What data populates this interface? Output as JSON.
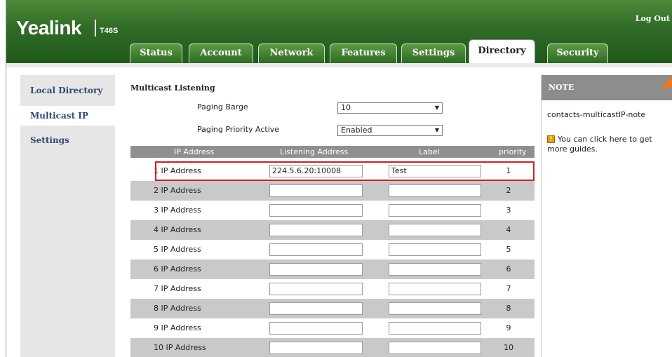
{
  "header": {
    "logo": "Yealink",
    "model": "T46S",
    "logout": "Log Out"
  },
  "tabs": [
    "Status",
    "Account",
    "Network",
    "Features",
    "Settings",
    "Directory",
    "Security"
  ],
  "active_tab": "Directory",
  "sidebar": {
    "items": [
      "Local Directory",
      "Multicast IP",
      "Settings"
    ],
    "active": "Multicast IP"
  },
  "section_title": "Multicast Listening",
  "paging_barge": {
    "label": "Paging Barge",
    "value": "10"
  },
  "paging_priority": {
    "label": "Paging Priority Active",
    "value": "Enabled"
  },
  "table": {
    "headers": [
      "IP Address",
      "Listening Address",
      "Label",
      "priority"
    ],
    "rows": [
      {
        "label": "1  IP Address",
        "address": "224.5.6.20:10008",
        "name": "Test",
        "priority": "1"
      },
      {
        "label": "2  IP Address",
        "address": "",
        "name": "",
        "priority": "2"
      },
      {
        "label": "3  IP Address",
        "address": "",
        "name": "",
        "priority": "3"
      },
      {
        "label": "4  IP Address",
        "address": "",
        "name": "",
        "priority": "4"
      },
      {
        "label": "5  IP Address",
        "address": "",
        "name": "",
        "priority": "5"
      },
      {
        "label": "6  IP Address",
        "address": "",
        "name": "",
        "priority": "6"
      },
      {
        "label": "7  IP Address",
        "address": "",
        "name": "",
        "priority": "7"
      },
      {
        "label": "8  IP Address",
        "address": "",
        "name": "",
        "priority": "8"
      },
      {
        "label": "9  IP Address",
        "address": "",
        "name": "",
        "priority": "9"
      },
      {
        "label": "10  IP Address",
        "address": "",
        "name": "",
        "priority": "10"
      }
    ]
  },
  "note": {
    "title": "NOTE",
    "key": "contacts-multicastIP-note",
    "text": "You can click here to get more guides.",
    "icon": "help-icon"
  }
}
